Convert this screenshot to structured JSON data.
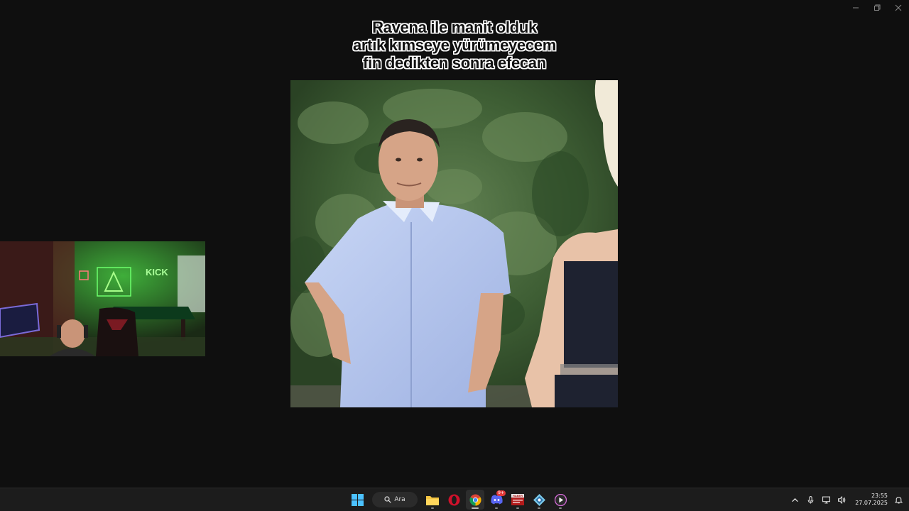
{
  "caption": {
    "line1": "Ravena ile manit olduk",
    "line2": "artık kımseye yürümeyecem",
    "line3": "fin dedikten sonra efecan"
  },
  "webcam": {
    "neon_sign": "KICK"
  },
  "taskbar": {
    "search_label": "Ara",
    "discord_badge": "9+",
    "news_icon_text": "HABER",
    "clock_time": "23:55",
    "clock_date": "27.07.2025"
  },
  "icons": {
    "start": "windows-start-icon",
    "search": "search-icon",
    "explorer": "folder-icon",
    "opera": "opera-icon",
    "chrome": "chrome-icon",
    "discord": "discord-icon",
    "news": "news-app-icon",
    "kick": "app-icon",
    "media": "media-player-icon"
  },
  "colors": {
    "accent_green": "#53fc18",
    "taskbar_bg": "#1c1c1c",
    "page_bg": "#0f0f0f"
  }
}
